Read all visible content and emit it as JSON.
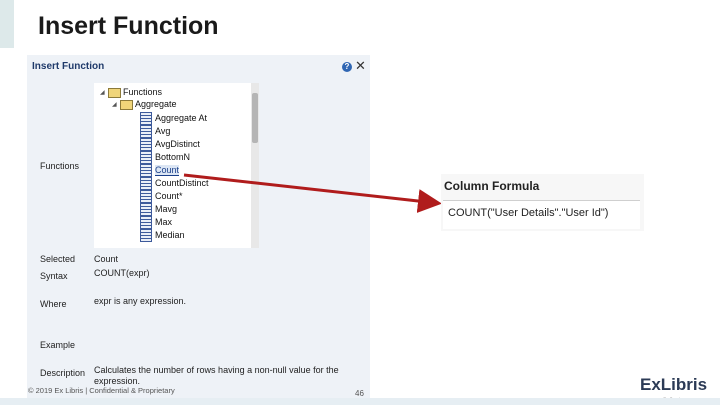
{
  "slide": {
    "title": "Insert Function"
  },
  "dialog": {
    "title": "Insert Function",
    "help_glyph": "?",
    "close_glyph": "✕",
    "labels": {
      "functions": "Functions",
      "selected": "Selected",
      "syntax": "Syntax",
      "where": "Where",
      "example": "Example",
      "description": "Description"
    },
    "values": {
      "selected": "Count",
      "syntax": "COUNT(expr)",
      "where": "expr is any expression.",
      "example": "",
      "description_line1": "Calculates the number of rows having a non-null value for the",
      "description_line2": "expression."
    },
    "tree": {
      "root": "Functions",
      "group": "Aggregate",
      "items": [
        "Aggregate At",
        "Avg",
        "AvgDistinct",
        "BottomN",
        "Count",
        "CountDistinct",
        "Count*",
        "Mavg",
        "Max",
        "Median"
      ],
      "selected_item": "Count"
    }
  },
  "formula_panel": {
    "title": "Column Formula",
    "value": "COUNT(\"User Details\".\"User Id\")"
  },
  "footer": {
    "copyright": "© 2019 Ex Libris | Confidential & Proprietary",
    "page_number": "46",
    "logo": "ExLibris",
    "logo_sub": "a ProQuest company"
  },
  "colors": {
    "arrow": "#b01c1c",
    "accent": "#dde9ea"
  }
}
